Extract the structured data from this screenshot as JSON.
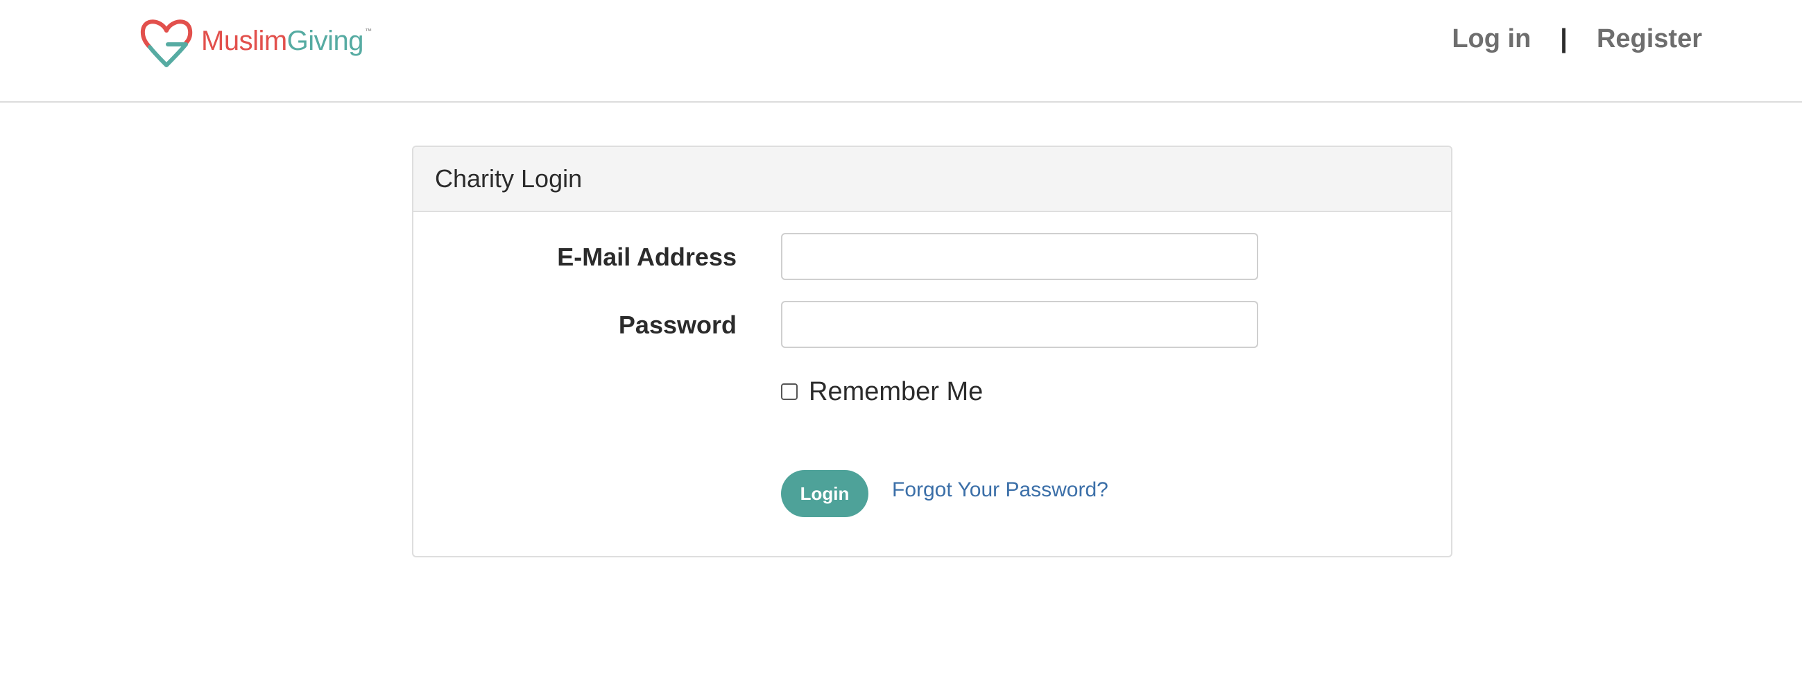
{
  "header": {
    "logo": {
      "brand_part1": "Muslim",
      "brand_part2": "Giving",
      "trademark": "™",
      "icon": "heart-g-logo-icon",
      "colors": {
        "red": "#e2504c",
        "teal": "#56aba2"
      }
    },
    "nav": {
      "login_label": "Log in",
      "separator": "|",
      "register_label": "Register"
    }
  },
  "card": {
    "title": "Charity Login",
    "form": {
      "email_label": "E-Mail Address",
      "email_value": "",
      "password_label": "Password",
      "password_value": "",
      "remember_label": "Remember Me",
      "remember_checked": false,
      "submit_label": "Login",
      "forgot_label": "Forgot Your Password?"
    }
  },
  "colors": {
    "accent": "#4ea299",
    "link": "#3b6fa8",
    "card_header_bg": "#f4f4f4"
  }
}
